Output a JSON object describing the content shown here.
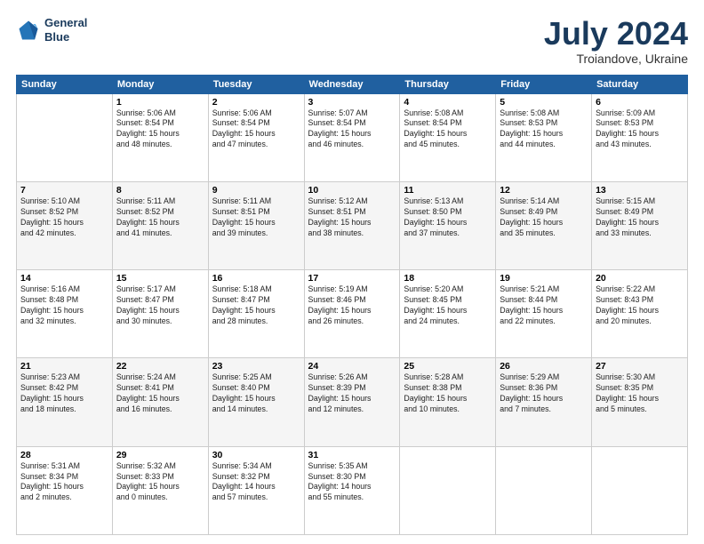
{
  "header": {
    "logo_line1": "General",
    "logo_line2": "Blue",
    "title": "July 2024",
    "subtitle": "Troiandove, Ukraine"
  },
  "days_of_week": [
    "Sunday",
    "Monday",
    "Tuesday",
    "Wednesday",
    "Thursday",
    "Friday",
    "Saturday"
  ],
  "weeks": [
    [
      {
        "day": "",
        "sunrise": "",
        "sunset": "",
        "daylight": ""
      },
      {
        "day": "1",
        "sunrise": "Sunrise: 5:06 AM",
        "sunset": "Sunset: 8:54 PM",
        "daylight": "Daylight: 15 hours and 48 minutes."
      },
      {
        "day": "2",
        "sunrise": "Sunrise: 5:06 AM",
        "sunset": "Sunset: 8:54 PM",
        "daylight": "Daylight: 15 hours and 47 minutes."
      },
      {
        "day": "3",
        "sunrise": "Sunrise: 5:07 AM",
        "sunset": "Sunset: 8:54 PM",
        "daylight": "Daylight: 15 hours and 46 minutes."
      },
      {
        "day": "4",
        "sunrise": "Sunrise: 5:08 AM",
        "sunset": "Sunset: 8:54 PM",
        "daylight": "Daylight: 15 hours and 45 minutes."
      },
      {
        "day": "5",
        "sunrise": "Sunrise: 5:08 AM",
        "sunset": "Sunset: 8:53 PM",
        "daylight": "Daylight: 15 hours and 44 minutes."
      },
      {
        "day": "6",
        "sunrise": "Sunrise: 5:09 AM",
        "sunset": "Sunset: 8:53 PM",
        "daylight": "Daylight: 15 hours and 43 minutes."
      }
    ],
    [
      {
        "day": "7",
        "sunrise": "Sunrise: 5:10 AM",
        "sunset": "Sunset: 8:52 PM",
        "daylight": "Daylight: 15 hours and 42 minutes."
      },
      {
        "day": "8",
        "sunrise": "Sunrise: 5:11 AM",
        "sunset": "Sunset: 8:52 PM",
        "daylight": "Daylight: 15 hours and 41 minutes."
      },
      {
        "day": "9",
        "sunrise": "Sunrise: 5:11 AM",
        "sunset": "Sunset: 8:51 PM",
        "daylight": "Daylight: 15 hours and 39 minutes."
      },
      {
        "day": "10",
        "sunrise": "Sunrise: 5:12 AM",
        "sunset": "Sunset: 8:51 PM",
        "daylight": "Daylight: 15 hours and 38 minutes."
      },
      {
        "day": "11",
        "sunrise": "Sunrise: 5:13 AM",
        "sunset": "Sunset: 8:50 PM",
        "daylight": "Daylight: 15 hours and 37 minutes."
      },
      {
        "day": "12",
        "sunrise": "Sunrise: 5:14 AM",
        "sunset": "Sunset: 8:49 PM",
        "daylight": "Daylight: 15 hours and 35 minutes."
      },
      {
        "day": "13",
        "sunrise": "Sunrise: 5:15 AM",
        "sunset": "Sunset: 8:49 PM",
        "daylight": "Daylight: 15 hours and 33 minutes."
      }
    ],
    [
      {
        "day": "14",
        "sunrise": "Sunrise: 5:16 AM",
        "sunset": "Sunset: 8:48 PM",
        "daylight": "Daylight: 15 hours and 32 minutes."
      },
      {
        "day": "15",
        "sunrise": "Sunrise: 5:17 AM",
        "sunset": "Sunset: 8:47 PM",
        "daylight": "Daylight: 15 hours and 30 minutes."
      },
      {
        "day": "16",
        "sunrise": "Sunrise: 5:18 AM",
        "sunset": "Sunset: 8:47 PM",
        "daylight": "Daylight: 15 hours and 28 minutes."
      },
      {
        "day": "17",
        "sunrise": "Sunrise: 5:19 AM",
        "sunset": "Sunset: 8:46 PM",
        "daylight": "Daylight: 15 hours and 26 minutes."
      },
      {
        "day": "18",
        "sunrise": "Sunrise: 5:20 AM",
        "sunset": "Sunset: 8:45 PM",
        "daylight": "Daylight: 15 hours and 24 minutes."
      },
      {
        "day": "19",
        "sunrise": "Sunrise: 5:21 AM",
        "sunset": "Sunset: 8:44 PM",
        "daylight": "Daylight: 15 hours and 22 minutes."
      },
      {
        "day": "20",
        "sunrise": "Sunrise: 5:22 AM",
        "sunset": "Sunset: 8:43 PM",
        "daylight": "Daylight: 15 hours and 20 minutes."
      }
    ],
    [
      {
        "day": "21",
        "sunrise": "Sunrise: 5:23 AM",
        "sunset": "Sunset: 8:42 PM",
        "daylight": "Daylight: 15 hours and 18 minutes."
      },
      {
        "day": "22",
        "sunrise": "Sunrise: 5:24 AM",
        "sunset": "Sunset: 8:41 PM",
        "daylight": "Daylight: 15 hours and 16 minutes."
      },
      {
        "day": "23",
        "sunrise": "Sunrise: 5:25 AM",
        "sunset": "Sunset: 8:40 PM",
        "daylight": "Daylight: 15 hours and 14 minutes."
      },
      {
        "day": "24",
        "sunrise": "Sunrise: 5:26 AM",
        "sunset": "Sunset: 8:39 PM",
        "daylight": "Daylight: 15 hours and 12 minutes."
      },
      {
        "day": "25",
        "sunrise": "Sunrise: 5:28 AM",
        "sunset": "Sunset: 8:38 PM",
        "daylight": "Daylight: 15 hours and 10 minutes."
      },
      {
        "day": "26",
        "sunrise": "Sunrise: 5:29 AM",
        "sunset": "Sunset: 8:36 PM",
        "daylight": "Daylight: 15 hours and 7 minutes."
      },
      {
        "day": "27",
        "sunrise": "Sunrise: 5:30 AM",
        "sunset": "Sunset: 8:35 PM",
        "daylight": "Daylight: 15 hours and 5 minutes."
      }
    ],
    [
      {
        "day": "28",
        "sunrise": "Sunrise: 5:31 AM",
        "sunset": "Sunset: 8:34 PM",
        "daylight": "Daylight: 15 hours and 2 minutes."
      },
      {
        "day": "29",
        "sunrise": "Sunrise: 5:32 AM",
        "sunset": "Sunset: 8:33 PM",
        "daylight": "Daylight: 15 hours and 0 minutes."
      },
      {
        "day": "30",
        "sunrise": "Sunrise: 5:34 AM",
        "sunset": "Sunset: 8:32 PM",
        "daylight": "Daylight: 14 hours and 57 minutes."
      },
      {
        "day": "31",
        "sunrise": "Sunrise: 5:35 AM",
        "sunset": "Sunset: 8:30 PM",
        "daylight": "Daylight: 14 hours and 55 minutes."
      },
      {
        "day": "",
        "sunrise": "",
        "sunset": "",
        "daylight": ""
      },
      {
        "day": "",
        "sunrise": "",
        "sunset": "",
        "daylight": ""
      },
      {
        "day": "",
        "sunrise": "",
        "sunset": "",
        "daylight": ""
      }
    ]
  ]
}
